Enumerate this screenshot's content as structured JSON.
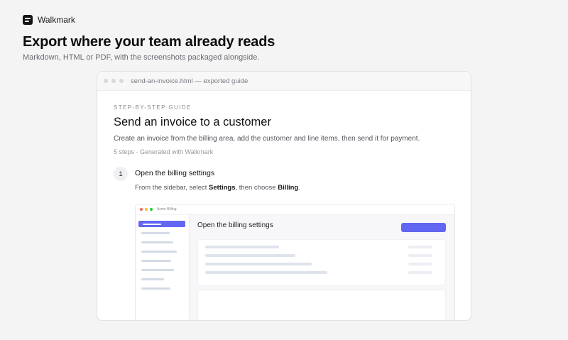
{
  "brand": {
    "name": "Walkmark"
  },
  "hero": {
    "title": "Export where your team already reads",
    "subtitle": "Markdown, HTML or PDF, with the screenshots packaged alongside."
  },
  "window": {
    "title": "send-an-invoice.html — exported guide"
  },
  "doc": {
    "eyebrow": "STEP-BY-STEP GUIDE",
    "title": "Send an invoice to a customer",
    "description": "Create an invoice from the billing area, add the customer and line items, then send it for payment.",
    "meta": "5 steps · Generated with Walkmark"
  },
  "step": {
    "number": "1",
    "title": "Open the billing settings",
    "desc_prefix": "From the sidebar, select ",
    "desc_bold1": "Settings",
    "desc_middle": ", then choose ",
    "desc_bold2": "Billing",
    "desc_suffix": "."
  },
  "screenshot": {
    "app_name": "Acme Billing",
    "page_title": "Open the billing settings",
    "colors": {
      "accent": "#6366f1",
      "red": "#ff5f57",
      "yellow": "#febc2e",
      "green": "#28c840"
    }
  }
}
